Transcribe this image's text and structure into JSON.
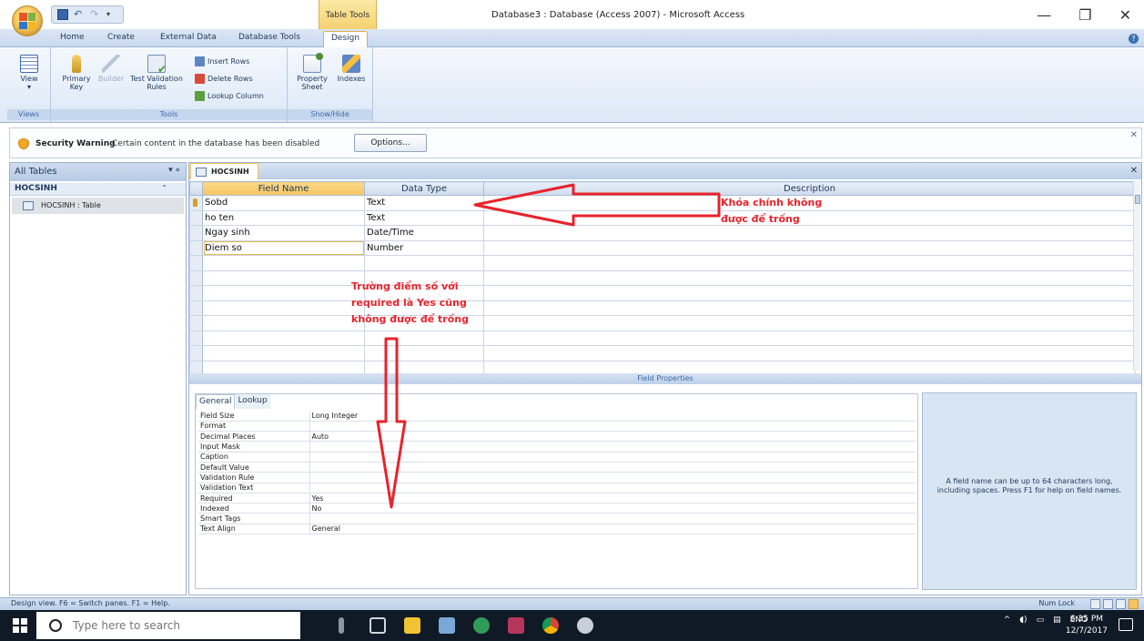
{
  "window": {
    "title": "Database3 : Database (Access 2007) - Microsoft Access",
    "contextual_tab": "Table Tools",
    "controls": {
      "minimize": "—",
      "restore": "❐",
      "close": "✕"
    }
  },
  "ribbon_tabs": [
    "Home",
    "Create",
    "External Data",
    "Database Tools",
    "Design"
  ],
  "ribbon": {
    "groups": {
      "views": "Views",
      "tools": "Tools",
      "show_hide": "Show/Hide"
    },
    "buttons": {
      "view": "View",
      "primary_key_1": "Primary",
      "primary_key_2": "Key",
      "builder": "Builder",
      "test_validation_1": "Test Validation",
      "test_validation_2": "Rules",
      "insert_rows": "Insert Rows",
      "delete_rows": "Delete Rows",
      "lookup_column": "Lookup Column",
      "property_sheet_1": "Property",
      "property_sheet_2": "Sheet",
      "indexes": "Indexes"
    }
  },
  "security_bar": {
    "label": "Security Warning",
    "message": "Certain content in the database has been disabled",
    "button": "Options..."
  },
  "nav_pane": {
    "header": "All Tables",
    "group": "HOCSINH",
    "item": "HOCSINH : Table"
  },
  "document": {
    "tab": "HOCSINH",
    "columns": [
      "Field Name",
      "Data Type",
      "Description"
    ],
    "rows": [
      {
        "field": "Sobd",
        "type": "Text",
        "desc": ""
      },
      {
        "field": "ho ten",
        "type": "Text",
        "desc": ""
      },
      {
        "field": "Ngay sinh",
        "type": "Date/Time",
        "desc": ""
      },
      {
        "field": "Diem so",
        "type": "Number",
        "desc": ""
      }
    ],
    "field_properties_label": "Field Properties"
  },
  "field_properties": {
    "tabs": [
      "General",
      "Lookup"
    ],
    "props": [
      {
        "name": "Field Size",
        "value": "Long Integer"
      },
      {
        "name": "Format",
        "value": ""
      },
      {
        "name": "Decimal Places",
        "value": "Auto"
      },
      {
        "name": "Input Mask",
        "value": ""
      },
      {
        "name": "Caption",
        "value": ""
      },
      {
        "name": "Default Value",
        "value": ""
      },
      {
        "name": "Validation Rule",
        "value": ""
      },
      {
        "name": "Validation Text",
        "value": ""
      },
      {
        "name": "Required",
        "value": "Yes"
      },
      {
        "name": "Indexed",
        "value": "No"
      },
      {
        "name": "Smart Tags",
        "value": ""
      },
      {
        "name": "Text Align",
        "value": "General"
      }
    ],
    "help_text": "A field name can be up to 64 characters long, including spaces.  Press F1 for help on field names."
  },
  "annotations": {
    "primary_key_1": "Khóa chính không",
    "primary_key_2": "được để trống",
    "score_1": "Trường điểm số với",
    "score_2": "required là Yes cũng",
    "score_3": "không được để trống",
    "color": "#e8232b"
  },
  "statusbar": {
    "left": "Design view.  F6 = Switch panes.  F1 = Help.",
    "right": "Num Lock"
  },
  "taskbar": {
    "search_placeholder": "Type here to search",
    "lang": "ENG",
    "time": "6:35 PM",
    "date": "12/7/2017"
  }
}
